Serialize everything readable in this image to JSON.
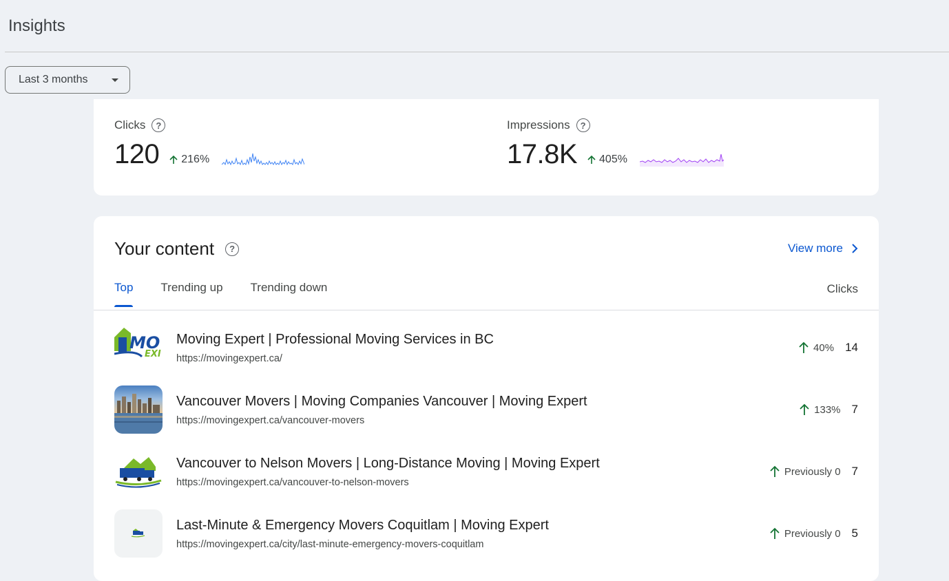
{
  "page_title": "Insights",
  "date_range": {
    "label": "Last 3 months"
  },
  "metrics": {
    "clicks": {
      "label": "Clicks",
      "value": "120",
      "change": "216%"
    },
    "impressions": {
      "label": "Impressions",
      "value": "17.8K",
      "change": "405%"
    }
  },
  "content": {
    "title": "Your content",
    "view_more": "View more",
    "tabs": [
      "Top",
      "Trending up",
      "Trending down"
    ],
    "column_header": "Clicks",
    "rows": [
      {
        "title": "Moving Expert | Professional Moving Services in BC",
        "url": "https://movingexpert.ca/",
        "change": "40%",
        "clicks": "14",
        "thumb": "logo-thumbnail"
      },
      {
        "title": "Vancouver Movers | Moving Companies Vancouver | Moving Expert",
        "url": "https://movingexpert.ca/vancouver-movers",
        "change": "133%",
        "clicks": "7",
        "thumb": "city-skyline-thumbnail"
      },
      {
        "title": "Vancouver to Nelson Movers | Long-Distance Moving | Moving Expert",
        "url": "https://movingexpert.ca/vancouver-to-nelson-movers",
        "change": "Previously 0",
        "clicks": "7",
        "thumb": "truck-logo-thumbnail"
      },
      {
        "title": "Last-Minute & Emergency Movers Coquitlam | Moving Expert",
        "url": "https://movingexpert.ca/city/last-minute-emergency-movers-coquitlam",
        "change": "Previously 0",
        "clicks": "5",
        "thumb": "small-truck-thumbnail"
      }
    ]
  },
  "colors": {
    "accent": "#0b57d0",
    "positive": "#137333",
    "clicks_sparkline": "#4285f4",
    "impressions_sparkline": "#a142f4"
  }
}
